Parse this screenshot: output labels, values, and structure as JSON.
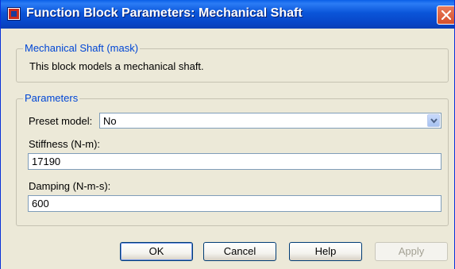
{
  "window": {
    "title": "Function Block Parameters: Mechanical Shaft"
  },
  "mask": {
    "legend": "Mechanical Shaft (mask)",
    "description": "This block models a mechanical shaft."
  },
  "parameters": {
    "legend": "Parameters",
    "preset_label": "Preset model:",
    "preset_value": "No",
    "stiffness_label": "Stiffness (N-m):",
    "stiffness_value": "17190",
    "damping_label": "Damping (N-m-s):",
    "damping_value": "600"
  },
  "buttons": {
    "ok": "OK",
    "cancel": "Cancel",
    "help": "Help",
    "apply": "Apply"
  },
  "colors": {
    "titlebar": "#0a55d9",
    "legend_text": "#0046d5",
    "dialog_bg": "#ece9d8",
    "close_button": "#d6502c"
  }
}
